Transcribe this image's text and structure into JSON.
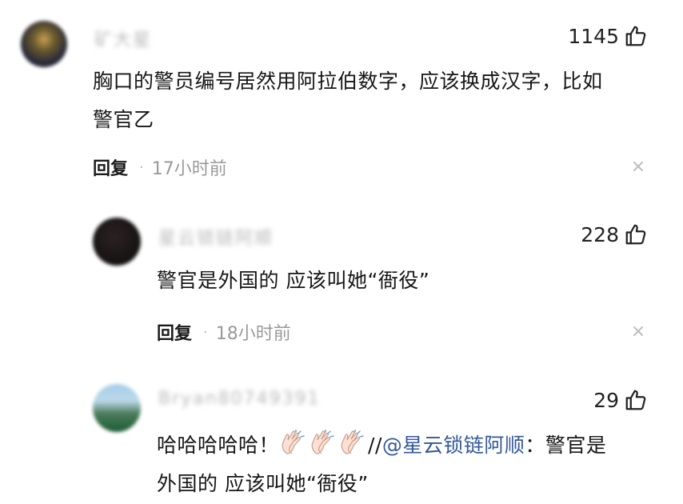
{
  "comments": [
    {
      "username": "矿大星",
      "likes": "1145",
      "text_line1": "胸口的警员编号居然用阿拉伯数字，应该换成汉字，比如",
      "text_line2": "警官乙",
      "reply_label": "回复",
      "time": "17小时前"
    },
    {
      "username": "星云锁链阿顺",
      "likes": "228",
      "text": "警官是外国的 应该叫她“衙役”",
      "reply_label": "回复",
      "time": "18小时前"
    },
    {
      "username": "Bryan80749391",
      "likes": "29",
      "text_prefix": "哈哈哈哈哈！",
      "separator": "//",
      "mention": "@星云锁链阿顺",
      "text_after": "：警官是",
      "text_line2": "外国的 应该叫她“衙役”"
    }
  ],
  "icons": {
    "like": "thumbs-up-icon",
    "close": "close-icon",
    "clap": "clapping-hands-emoji"
  },
  "colors": {
    "mention": "#33589a",
    "secondary_text": "#9a9a9a"
  }
}
